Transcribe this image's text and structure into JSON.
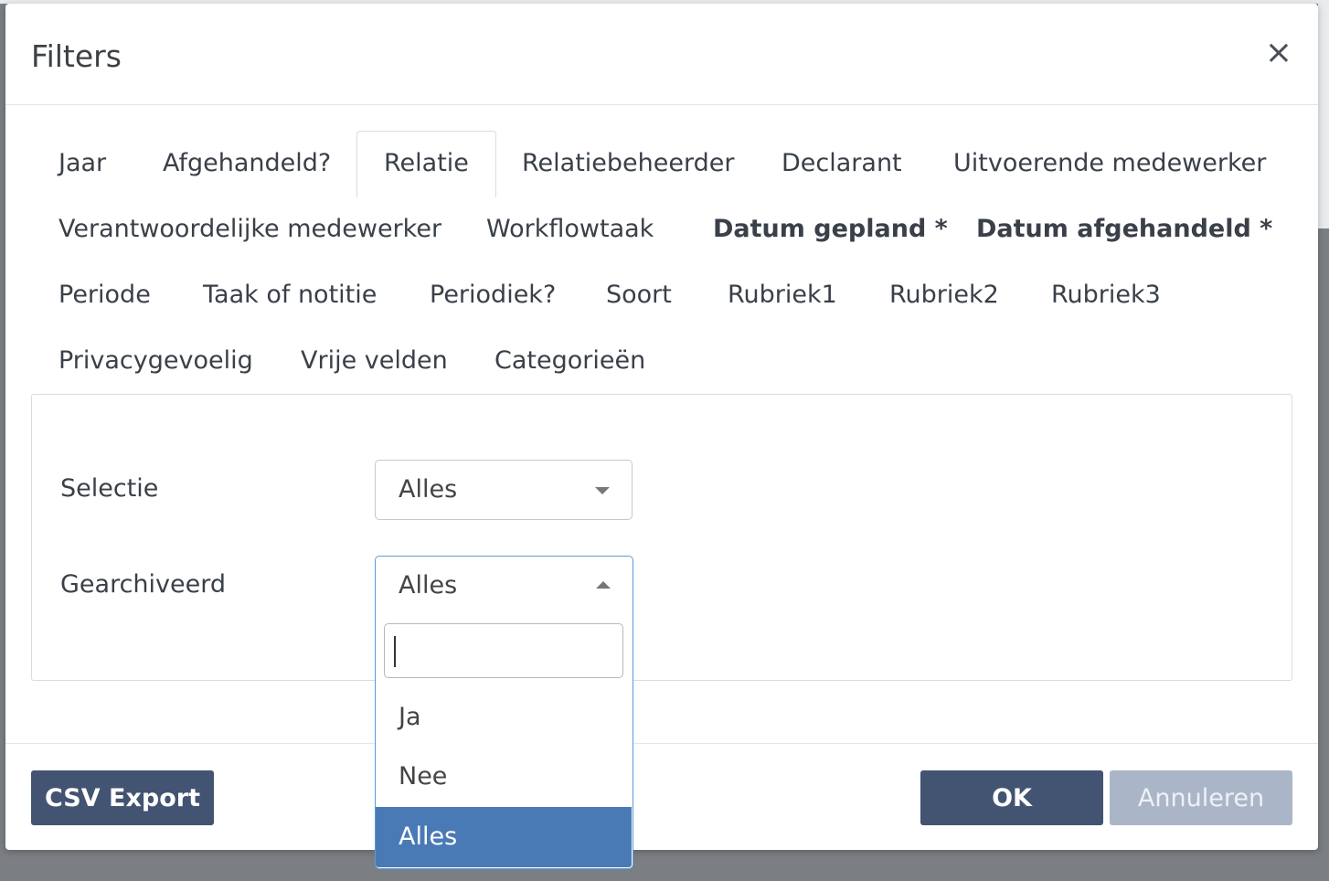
{
  "modal": {
    "title": "Filters",
    "close_label": "×"
  },
  "tabs": [
    {
      "label": "Jaar",
      "bold": false,
      "active": false
    },
    {
      "label": "Afgehandeld?",
      "bold": false,
      "active": false
    },
    {
      "label": "Relatie",
      "bold": false,
      "active": true
    },
    {
      "label": "Relatiebeheerder",
      "bold": false,
      "active": false
    },
    {
      "label": "Declarant",
      "bold": false,
      "active": false
    },
    {
      "label": "Uitvoerende medewerker",
      "bold": false,
      "active": false
    },
    {
      "label": "Verantwoordelijke medewerker",
      "bold": false,
      "active": false
    },
    {
      "label": "Workflowtaak",
      "bold": false,
      "active": false
    },
    {
      "label": "Datum gepland *",
      "bold": true,
      "active": false
    },
    {
      "label": "Datum afgehandeld *",
      "bold": true,
      "active": false
    },
    {
      "label": "Periode",
      "bold": false,
      "active": false
    },
    {
      "label": "Taak of notitie",
      "bold": false,
      "active": false
    },
    {
      "label": "Periodiek?",
      "bold": false,
      "active": false
    },
    {
      "label": "Soort",
      "bold": false,
      "active": false
    },
    {
      "label": "Rubriek1",
      "bold": false,
      "active": false
    },
    {
      "label": "Rubriek2",
      "bold": false,
      "active": false
    },
    {
      "label": "Rubriek3",
      "bold": false,
      "active": false
    },
    {
      "label": "Privacygevoelig",
      "bold": false,
      "active": false
    },
    {
      "label": "Vrije velden",
      "bold": false,
      "active": false
    },
    {
      "label": "Categorieën",
      "bold": false,
      "active": false
    }
  ],
  "form": {
    "selectie": {
      "label": "Selectie",
      "value": "Alles"
    },
    "gearchiveerd": {
      "label": "Gearchiveerd",
      "value": "Alles",
      "search_value": "",
      "options": [
        {
          "label": "Ja",
          "selected": false
        },
        {
          "label": "Nee",
          "selected": false
        },
        {
          "label": "Alles",
          "selected": true
        }
      ]
    }
  },
  "footer": {
    "csv_export_label": "CSV Export",
    "ok_label": "OK",
    "cancel_label": "Annuleren"
  },
  "colors": {
    "primary": "#435372",
    "disabled": "#aab6c8",
    "focus": "#5a9bd8",
    "selected_option": "#4a7ab5",
    "backdrop": "#7b7f83"
  }
}
